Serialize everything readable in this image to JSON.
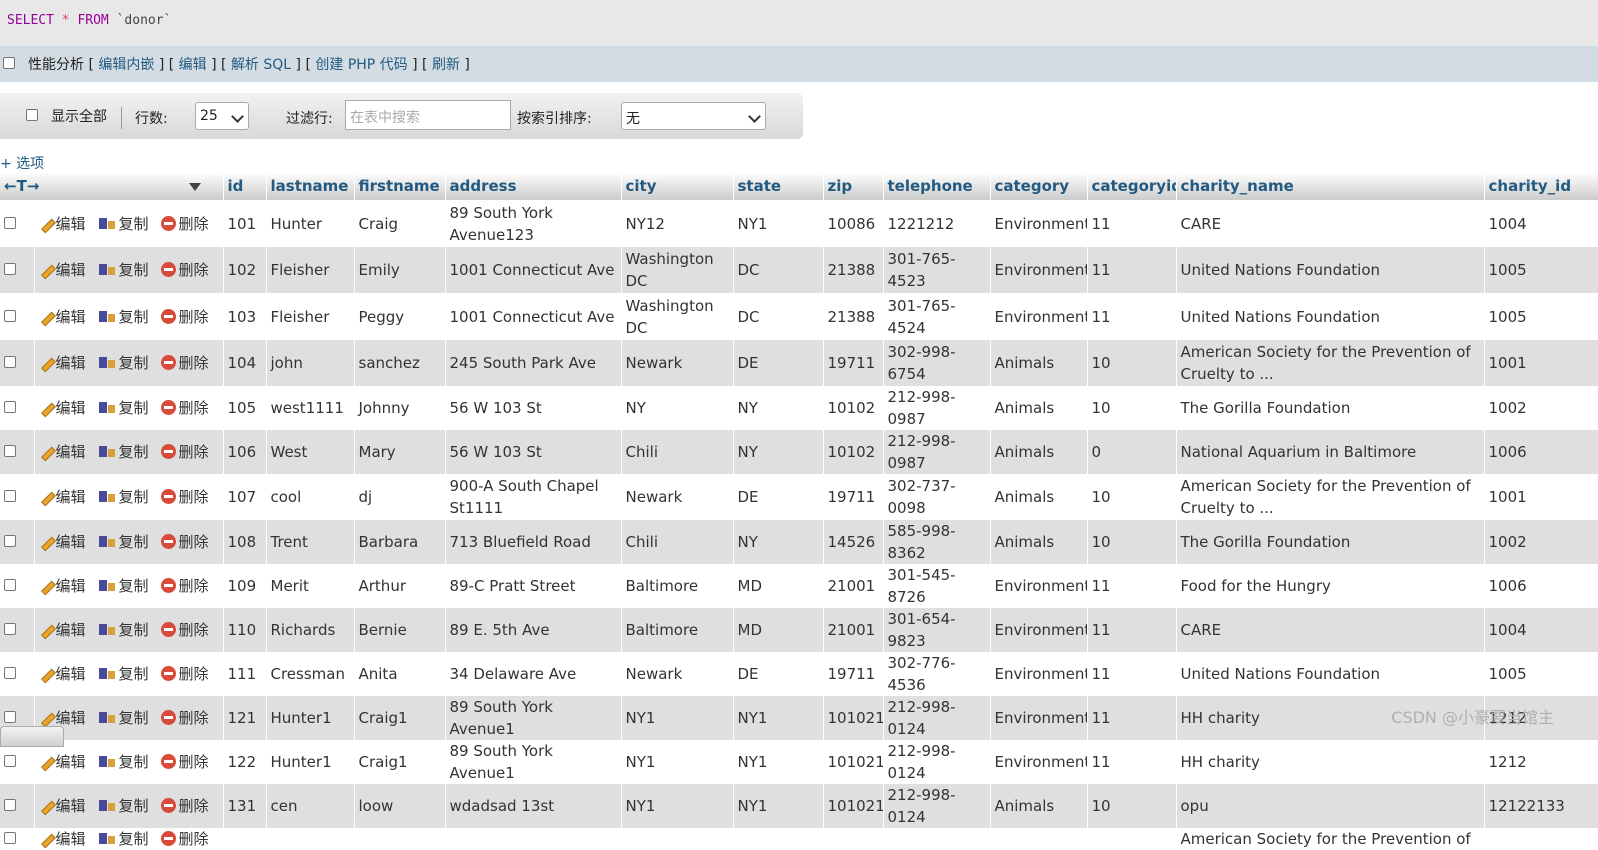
{
  "sql": {
    "select": "SELECT",
    "star": "*",
    "from": "FROM",
    "table": "`donor`"
  },
  "links": {
    "profiling": "性能分析",
    "edit_inline": "编辑内嵌",
    "edit": "编辑",
    "explain": "解析 SQL",
    "create_php": "创建 PHP 代码",
    "refresh": "刷新"
  },
  "nav": {
    "show_all": "显示全部",
    "rows_label": "行数:",
    "rows_value": "25",
    "filter_label": "过滤行:",
    "filter_placeholder": "在表中搜索",
    "sort_label": "按索引排序:",
    "sort_value": "无"
  },
  "options_label": "+ 选项",
  "actions": {
    "edit": "编辑",
    "copy": "复制",
    "delete": "删除"
  },
  "columns": [
    "id",
    "lastname",
    "firstname",
    "address",
    "city",
    "state",
    "zip",
    "telephone",
    "category",
    "categoryid",
    "charity_name",
    "charity_id"
  ],
  "rows": [
    [
      "101",
      "Hunter",
      "Craig",
      "89 South York Avenue123",
      "NY12",
      "NY1",
      "10086",
      "1221212",
      "Environment",
      "11",
      "CARE",
      "1004"
    ],
    [
      "102",
      "Fleisher",
      "Emily",
      "1001 Connecticut Ave",
      "Washington DC",
      "DC",
      "21388",
      "301-765-4523",
      "Environment",
      "11",
      "United Nations Foundation",
      "1005"
    ],
    [
      "103",
      "Fleisher",
      "Peggy",
      "1001 Connecticut Ave",
      "Washington DC",
      "DC",
      "21388",
      "301-765-4524",
      "Environment",
      "11",
      "United Nations Foundation",
      "1005"
    ],
    [
      "104",
      "john",
      "sanchez",
      "245 South Park Ave",
      "Newark",
      "DE",
      "19711",
      "302-998-6754",
      "Animals",
      "10",
      "American Society for the Prevention of Cruelty to ...",
      "1001"
    ],
    [
      "105",
      "west1111",
      "Johnny",
      "56 W 103 St",
      "NY",
      "NY",
      "10102",
      "212-998-0987",
      "Animals",
      "10",
      "The Gorilla Foundation",
      "1002"
    ],
    [
      "106",
      "West",
      "Mary",
      "56 W 103 St",
      "Chili",
      "NY",
      "10102",
      "212-998-0987",
      "Animals",
      "0",
      "National Aquarium in Baltimore",
      "1006"
    ],
    [
      "107",
      "cool",
      "dj",
      "900-A South Chapel St1111",
      "Newark",
      "DE",
      "19711",
      "302-737-0098",
      "Animals",
      "10",
      "American Society for the Prevention of Cruelty to ...",
      "1001"
    ],
    [
      "108",
      "Trent",
      "Barbara",
      "713 Bluefield Road",
      "Chili",
      "NY",
      "14526",
      "585-998-8362",
      "Animals",
      "10",
      "The Gorilla Foundation",
      "1002"
    ],
    [
      "109",
      "Merit",
      "Arthur",
      "89-C Pratt Street",
      "Baltimore",
      "MD",
      "21001",
      "301-545-8726",
      "Environment",
      "11",
      "Food for the Hungry",
      "1006"
    ],
    [
      "110",
      "Richards",
      "Bernie",
      "89 E. 5th Ave",
      "Baltimore",
      "MD",
      "21001",
      "301-654-9823",
      "Environment",
      "11",
      "CARE",
      "1004"
    ],
    [
      "111",
      "Cressman",
      "Anita",
      "34 Delaware Ave",
      "Newark",
      "DE",
      "19711",
      "302-776-4536",
      "Environment",
      "11",
      "United Nations Foundation",
      "1005"
    ],
    [
      "121",
      "Hunter1",
      "Craig1",
      "89 South York Avenue1",
      "NY1",
      "NY1",
      "101021",
      "212-998-0124",
      "Environment",
      "11",
      "HH charity",
      "1212"
    ],
    [
      "122",
      "Hunter1",
      "Craig1",
      "89 South York Avenue1",
      "NY1",
      "NY1",
      "101021",
      "212-998-0124",
      "Environment",
      "11",
      "HH charity",
      "1212"
    ],
    [
      "131",
      "cen",
      "loow",
      "wdadsad 13st",
      "NY1",
      "NY1",
      "101021",
      "212-998-0124",
      "Animals",
      "10",
      "opu",
      "12122133"
    ],
    [
      "",
      "",
      "",
      "",
      "",
      "",
      "",
      "",
      "",
      "",
      "American Society for the Prevention of",
      ""
    ]
  ],
  "row_heights": [
    47,
    46,
    47,
    46,
    31,
    32,
    46,
    31,
    31,
    32,
    31,
    31,
    32,
    31,
    20
  ],
  "watermark": "CSDN @小豪要当馆主"
}
